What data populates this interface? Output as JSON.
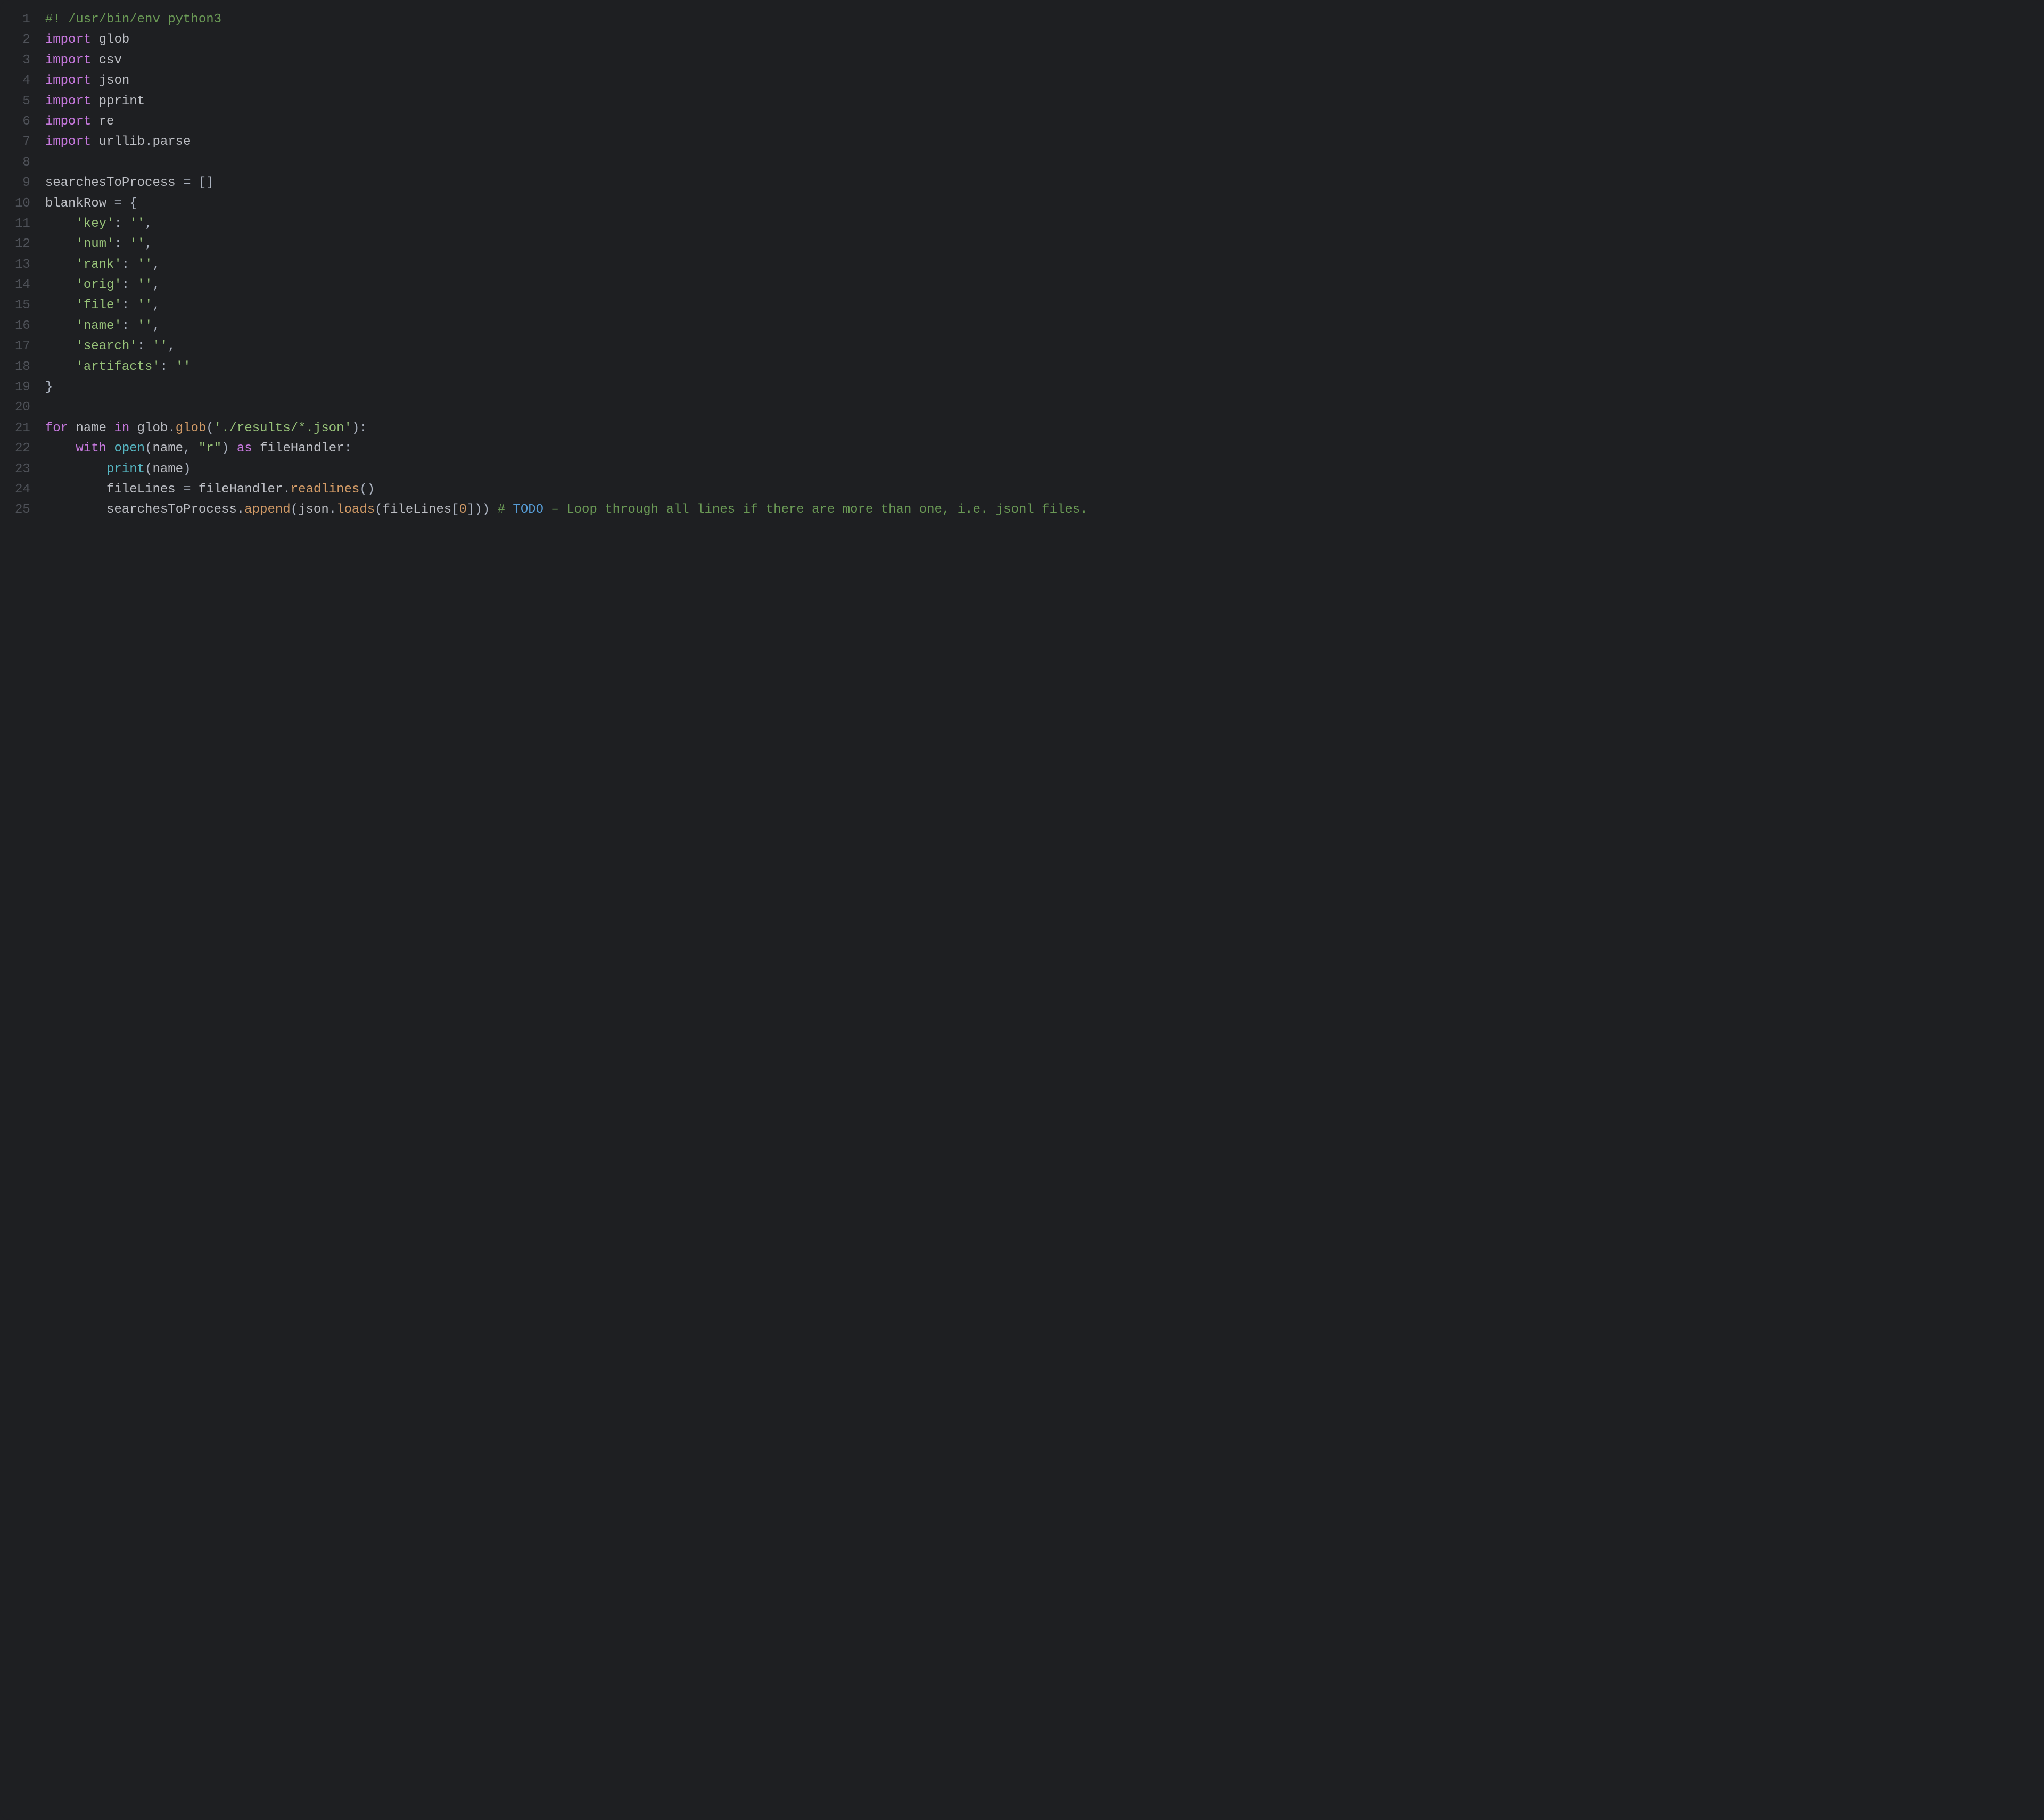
{
  "language": "python",
  "theme": "dark",
  "lines": [
    {
      "n": 1,
      "tokens": [
        {
          "t": "#! /usr/bin/env python3",
          "c": "comment"
        }
      ]
    },
    {
      "n": 2,
      "tokens": [
        {
          "t": "import",
          "c": "keyword"
        },
        {
          "t": " ",
          "c": "punct"
        },
        {
          "t": "glob",
          "c": "ident"
        }
      ]
    },
    {
      "n": 3,
      "tokens": [
        {
          "t": "import",
          "c": "keyword"
        },
        {
          "t": " ",
          "c": "punct"
        },
        {
          "t": "csv",
          "c": "ident"
        }
      ]
    },
    {
      "n": 4,
      "tokens": [
        {
          "t": "import",
          "c": "keyword"
        },
        {
          "t": " ",
          "c": "punct"
        },
        {
          "t": "json",
          "c": "ident"
        }
      ]
    },
    {
      "n": 5,
      "tokens": [
        {
          "t": "import",
          "c": "keyword"
        },
        {
          "t": " ",
          "c": "punct"
        },
        {
          "t": "pprint",
          "c": "ident"
        }
      ]
    },
    {
      "n": 6,
      "tokens": [
        {
          "t": "import",
          "c": "keyword"
        },
        {
          "t": " ",
          "c": "punct"
        },
        {
          "t": "re",
          "c": "ident"
        }
      ]
    },
    {
      "n": 7,
      "tokens": [
        {
          "t": "import",
          "c": "keyword"
        },
        {
          "t": " ",
          "c": "punct"
        },
        {
          "t": "urllib",
          "c": "ident"
        },
        {
          "t": ".",
          "c": "punct"
        },
        {
          "t": "parse",
          "c": "ident"
        }
      ]
    },
    {
      "n": 8,
      "tokens": [
        {
          "t": "",
          "c": "punct"
        }
      ]
    },
    {
      "n": 9,
      "tokens": [
        {
          "t": "searchesToProcess",
          "c": "ident"
        },
        {
          "t": " ",
          "c": "punct"
        },
        {
          "t": "=",
          "c": "op"
        },
        {
          "t": " ",
          "c": "punct"
        },
        {
          "t": "[]",
          "c": "punct"
        }
      ]
    },
    {
      "n": 10,
      "tokens": [
        {
          "t": "blankRow",
          "c": "ident"
        },
        {
          "t": " ",
          "c": "punct"
        },
        {
          "t": "=",
          "c": "op"
        },
        {
          "t": " ",
          "c": "punct"
        },
        {
          "t": "{",
          "c": "punct"
        }
      ]
    },
    {
      "n": 11,
      "tokens": [
        {
          "t": "    ",
          "c": "punct"
        },
        {
          "t": "'key'",
          "c": "string"
        },
        {
          "t": ":",
          "c": "punct"
        },
        {
          "t": " ",
          "c": "punct"
        },
        {
          "t": "''",
          "c": "string"
        },
        {
          "t": ",",
          "c": "punct"
        }
      ]
    },
    {
      "n": 12,
      "tokens": [
        {
          "t": "    ",
          "c": "punct"
        },
        {
          "t": "'num'",
          "c": "string"
        },
        {
          "t": ":",
          "c": "punct"
        },
        {
          "t": " ",
          "c": "punct"
        },
        {
          "t": "''",
          "c": "string"
        },
        {
          "t": ",",
          "c": "punct"
        }
      ]
    },
    {
      "n": 13,
      "tokens": [
        {
          "t": "    ",
          "c": "punct"
        },
        {
          "t": "'rank'",
          "c": "string"
        },
        {
          "t": ":",
          "c": "punct"
        },
        {
          "t": " ",
          "c": "punct"
        },
        {
          "t": "''",
          "c": "string"
        },
        {
          "t": ",",
          "c": "punct"
        }
      ]
    },
    {
      "n": 14,
      "tokens": [
        {
          "t": "    ",
          "c": "punct"
        },
        {
          "t": "'orig'",
          "c": "string"
        },
        {
          "t": ":",
          "c": "punct"
        },
        {
          "t": " ",
          "c": "punct"
        },
        {
          "t": "''",
          "c": "string"
        },
        {
          "t": ",",
          "c": "punct"
        }
      ]
    },
    {
      "n": 15,
      "tokens": [
        {
          "t": "    ",
          "c": "punct"
        },
        {
          "t": "'file'",
          "c": "string"
        },
        {
          "t": ":",
          "c": "punct"
        },
        {
          "t": " ",
          "c": "punct"
        },
        {
          "t": "''",
          "c": "string"
        },
        {
          "t": ",",
          "c": "punct"
        }
      ]
    },
    {
      "n": 16,
      "tokens": [
        {
          "t": "    ",
          "c": "punct"
        },
        {
          "t": "'name'",
          "c": "string"
        },
        {
          "t": ":",
          "c": "punct"
        },
        {
          "t": " ",
          "c": "punct"
        },
        {
          "t": "''",
          "c": "string"
        },
        {
          "t": ",",
          "c": "punct"
        }
      ]
    },
    {
      "n": 17,
      "tokens": [
        {
          "t": "    ",
          "c": "punct"
        },
        {
          "t": "'search'",
          "c": "string"
        },
        {
          "t": ":",
          "c": "punct"
        },
        {
          "t": " ",
          "c": "punct"
        },
        {
          "t": "''",
          "c": "string"
        },
        {
          "t": ",",
          "c": "punct"
        }
      ]
    },
    {
      "n": 18,
      "tokens": [
        {
          "t": "    ",
          "c": "punct"
        },
        {
          "t": "'artifacts'",
          "c": "string"
        },
        {
          "t": ":",
          "c": "punct"
        },
        {
          "t": " ",
          "c": "punct"
        },
        {
          "t": "''",
          "c": "string"
        }
      ]
    },
    {
      "n": 19,
      "tokens": [
        {
          "t": "}",
          "c": "punct"
        }
      ]
    },
    {
      "n": 20,
      "tokens": [
        {
          "t": "",
          "c": "punct"
        }
      ]
    },
    {
      "n": 21,
      "tokens": [
        {
          "t": "for",
          "c": "keyword"
        },
        {
          "t": " ",
          "c": "punct"
        },
        {
          "t": "name",
          "c": "ident"
        },
        {
          "t": " ",
          "c": "punct"
        },
        {
          "t": "in",
          "c": "keyword"
        },
        {
          "t": " ",
          "c": "punct"
        },
        {
          "t": "glob",
          "c": "ident"
        },
        {
          "t": ".",
          "c": "punct"
        },
        {
          "t": "glob",
          "c": "call"
        },
        {
          "t": "(",
          "c": "punct"
        },
        {
          "t": "'./results/*.json'",
          "c": "string"
        },
        {
          "t": ")",
          "c": "punct"
        },
        {
          "t": ":",
          "c": "punct"
        }
      ]
    },
    {
      "n": 22,
      "tokens": [
        {
          "t": "    ",
          "c": "punct"
        },
        {
          "t": "with",
          "c": "keyword"
        },
        {
          "t": " ",
          "c": "punct"
        },
        {
          "t": "open",
          "c": "builtin"
        },
        {
          "t": "(",
          "c": "punct"
        },
        {
          "t": "name",
          "c": "ident"
        },
        {
          "t": ",",
          "c": "punct"
        },
        {
          "t": " ",
          "c": "punct"
        },
        {
          "t": "\"r\"",
          "c": "string"
        },
        {
          "t": ")",
          "c": "punct"
        },
        {
          "t": " ",
          "c": "punct"
        },
        {
          "t": "as",
          "c": "keyword"
        },
        {
          "t": " ",
          "c": "punct"
        },
        {
          "t": "fileHandler",
          "c": "ident"
        },
        {
          "t": ":",
          "c": "punct"
        }
      ]
    },
    {
      "n": 23,
      "tokens": [
        {
          "t": "        ",
          "c": "punct"
        },
        {
          "t": "print",
          "c": "builtin"
        },
        {
          "t": "(",
          "c": "punct"
        },
        {
          "t": "name",
          "c": "ident"
        },
        {
          "t": ")",
          "c": "punct"
        }
      ]
    },
    {
      "n": 24,
      "tokens": [
        {
          "t": "        ",
          "c": "punct"
        },
        {
          "t": "fileLines",
          "c": "ident"
        },
        {
          "t": " ",
          "c": "punct"
        },
        {
          "t": "=",
          "c": "op"
        },
        {
          "t": " ",
          "c": "punct"
        },
        {
          "t": "fileHandler",
          "c": "ident"
        },
        {
          "t": ".",
          "c": "punct"
        },
        {
          "t": "readlines",
          "c": "call"
        },
        {
          "t": "()",
          "c": "punct"
        }
      ]
    },
    {
      "n": 25,
      "tokens": [
        {
          "t": "        ",
          "c": "punct"
        },
        {
          "t": "searchesToProcess",
          "c": "ident"
        },
        {
          "t": ".",
          "c": "punct"
        },
        {
          "t": "append",
          "c": "call"
        },
        {
          "t": "(",
          "c": "punct"
        },
        {
          "t": "json",
          "c": "ident"
        },
        {
          "t": ".",
          "c": "punct"
        },
        {
          "t": "loads",
          "c": "call"
        },
        {
          "t": "(",
          "c": "punct"
        },
        {
          "t": "fileLines",
          "c": "ident"
        },
        {
          "t": "[",
          "c": "punct"
        },
        {
          "t": "0",
          "c": "number"
        },
        {
          "t": "]",
          "c": "punct"
        },
        {
          "t": ")",
          "c": "punct"
        },
        {
          "t": ")",
          "c": "punct"
        },
        {
          "t": " ",
          "c": "punct"
        },
        {
          "t": "# ",
          "c": "comment"
        },
        {
          "t": "TODO",
          "c": "todo"
        },
        {
          "t": " – Loop through all lines if there are more than one, i.e. jsonl files.",
          "c": "comment"
        }
      ]
    }
  ]
}
